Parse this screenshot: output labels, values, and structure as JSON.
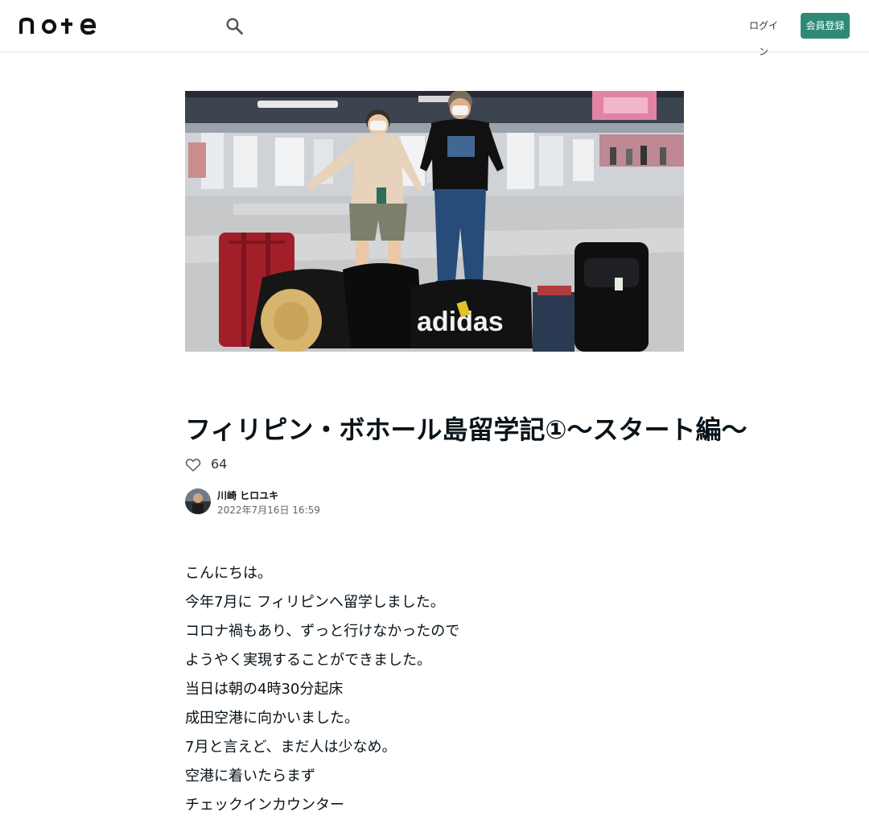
{
  "header": {
    "logo_text": "note",
    "login_label": "ログイン",
    "signup_label": "会員登録"
  },
  "article": {
    "title": "フィリピン・ボホール島留学記①〜スタート編〜",
    "like_count": "64",
    "author_name": "川崎 ヒロユキ",
    "date": "2022年7月16日 16:59",
    "paragraphs": [
      "こんにちは。",
      "今年7月に フィリピンへ留学しました。",
      "コロナ禍もあり、ずっと行けなかったので",
      "ようやく実現することができました。",
      "当日は朝の4時30分起床",
      "成田空港に向かいました。",
      "7月と言えど、まだ人は少なめ。",
      "空港に着いたらまず",
      "チェックインカウンター"
    ]
  },
  "hero_image": {
    "bag_print": "adidas"
  },
  "colors": {
    "accent": "#2e8a76",
    "text": "#08131a"
  }
}
